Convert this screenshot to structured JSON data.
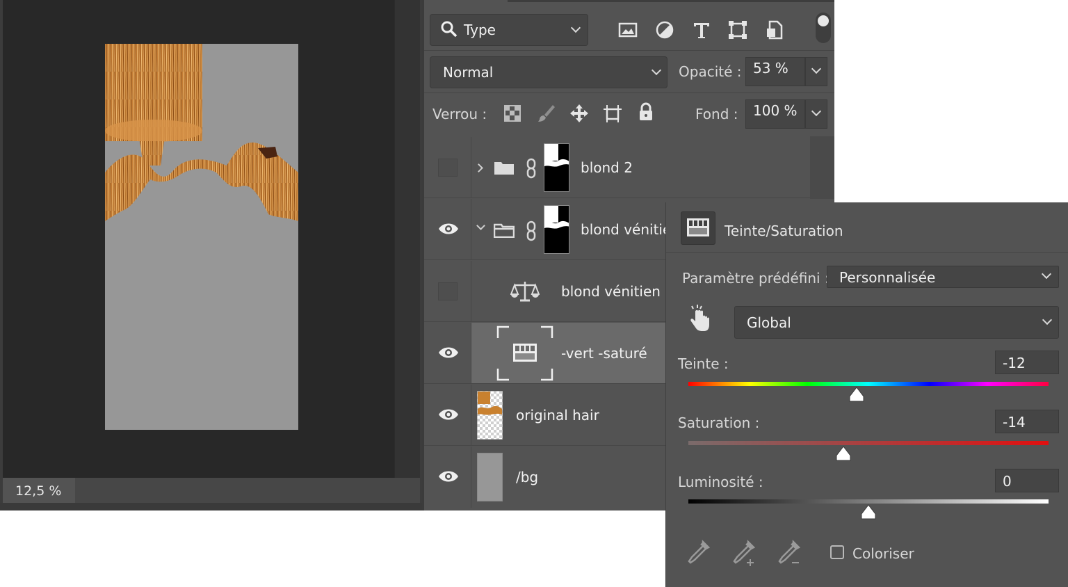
{
  "canvas": {
    "zoom": "12,5 %"
  },
  "layers_panel": {
    "filter": {
      "value": "Type",
      "icon": "search-icon"
    },
    "filter_icons": [
      "image-filter-icon",
      "adjustment-filter-icon",
      "type-filter-icon",
      "shape-filter-icon",
      "smart-object-filter-icon"
    ],
    "blend_mode": "Normal",
    "opacity_label": "Opacité :",
    "opacity_value": "53 %",
    "lock_label": "Verrou :",
    "lock_icons": [
      "lock-transparent-icon",
      "lock-paint-icon",
      "lock-move-icon",
      "lock-artboard-icon",
      "lock-all-icon"
    ],
    "fill_label": "Fond :",
    "fill_value": "100 %",
    "layers": [
      {
        "name": "blond 2",
        "visible": false,
        "type": "group",
        "expanded": false
      },
      {
        "name": "blond vénitie",
        "visible": true,
        "type": "group",
        "expanded": true
      },
      {
        "name": "blond vénitien",
        "visible": false,
        "type": "balance"
      },
      {
        "name": "-vert -saturé",
        "visible": true,
        "type": "hue-saturation",
        "selected": true
      },
      {
        "name": "original hair",
        "visible": true,
        "type": "pixel"
      },
      {
        "name": "/bg",
        "visible": true,
        "type": "fill"
      }
    ]
  },
  "properties": {
    "title": "Teinte/Saturation",
    "preset_label": "Paramètre prédéfini :",
    "preset_value": "Personnalisée",
    "channel_value": "Global",
    "hue": {
      "label": "Teinte :",
      "value": "-12",
      "numeric": -12,
      "min": -180,
      "max": 180
    },
    "saturation": {
      "label": "Saturation :",
      "value": "-14",
      "numeric": -14,
      "min": -100,
      "max": 100
    },
    "lightness": {
      "label": "Luminosité :",
      "value": "0",
      "numeric": 0,
      "min": -100,
      "max": 100
    },
    "colorize_label": "Coloriser",
    "colorize_checked": false
  },
  "colors": {
    "panel_bg": "#535353",
    "canvas_bg": "#282828",
    "doc_bg": "#979797",
    "hair": "#c9812f"
  }
}
